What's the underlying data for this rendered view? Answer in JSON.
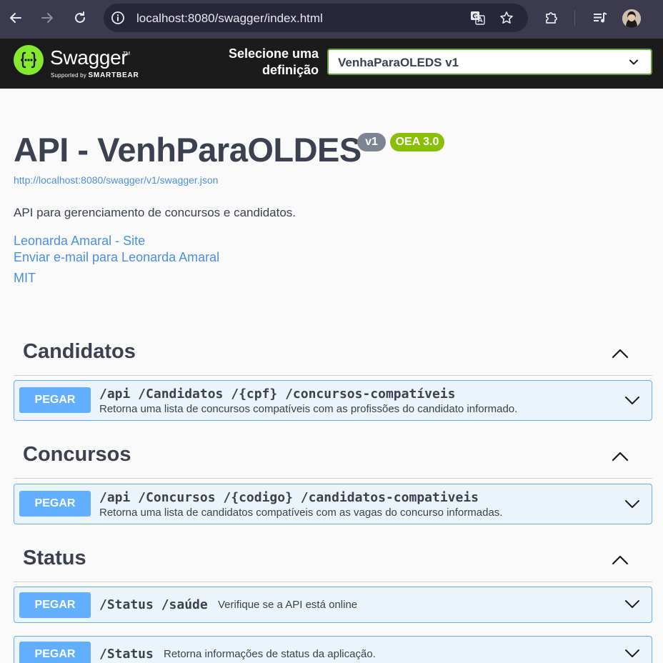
{
  "browser": {
    "url": "localhost:8080/swagger/index.html"
  },
  "topbar": {
    "logo_title": "Swagger",
    "logo_tm": "TM",
    "logo_sub_prefix": "Supported by",
    "logo_sub_brand": "SMARTBEAR",
    "select_label_line1": "Selecione uma",
    "select_label_line2": "definição",
    "selected_definition": "VenhaParaOLEDS v1"
  },
  "info": {
    "title": "API - VenhParaOLDES",
    "version_badge": "v1",
    "oas_badge": "OEA 3.0",
    "spec_url": "http://localhost:8080/swagger/v1/swagger.json",
    "description": "API para gerenciamento de concursos e candidatos.",
    "contact_site": "Leonarda Amaral - Site",
    "contact_email": "Enviar e-mail para Leonarda Amaral",
    "license": "MIT"
  },
  "tags": [
    {
      "name": "Candidatos",
      "operations": [
        {
          "method": "PEGAR",
          "path": "/api /Candidatos /{cpf} /concursos-compatíveis",
          "summary": "Retorna uma lista de concursos compatíveis com as profissões do candidato informado."
        }
      ]
    },
    {
      "name": "Concursos",
      "operations": [
        {
          "method": "PEGAR",
          "path": "/api /Concursos /{codigo} /candidatos-compativeis",
          "summary": "Retorna uma lista de candidatos compatíveis com as vagas do concurso informadas."
        }
      ]
    },
    {
      "name": "Status",
      "operations": [
        {
          "method": "PEGAR",
          "path": "/Status /saúde",
          "summary": "Verifique se a API está online"
        },
        {
          "method": "PEGAR",
          "path": "/Status",
          "summary": "Retorna informações de status da aplicação."
        }
      ]
    }
  ],
  "colors": {
    "chrome_bg": "#3c3a4f",
    "topbar_bg": "#1b1b1b",
    "swagger_green": "#85ea2d",
    "get_blue": "#61affe",
    "get_bg": "#ebf3fb",
    "link_blue": "#4990e2",
    "version_grey": "#7d8492",
    "oas_green": "#89bf04"
  },
  "icons": {
    "back": "arrow-left-icon",
    "forward": "arrow-right-icon",
    "reload": "reload-icon",
    "site_info": "info-icon",
    "translate": "translate-icon",
    "bookmark": "star-icon",
    "extensions": "puzzle-icon",
    "media": "playlist-icon",
    "collapse": "chevron-up-icon",
    "expand": "chevron-down-icon"
  }
}
